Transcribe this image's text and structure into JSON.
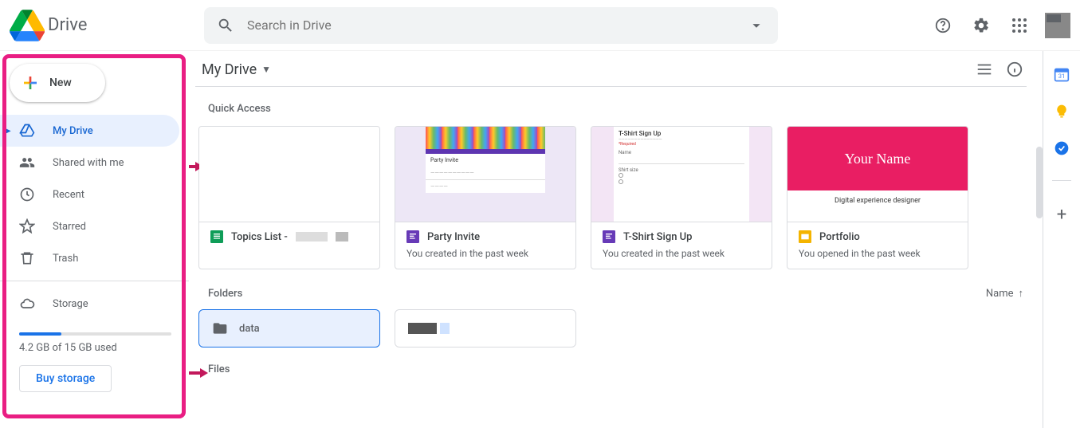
{
  "header": {
    "app_name": "Drive",
    "search_placeholder": "Search in Drive"
  },
  "sidebar": {
    "new_label": "New",
    "items": [
      {
        "label": "My Drive",
        "icon": "drive"
      },
      {
        "label": "Shared with me",
        "icon": "shared"
      },
      {
        "label": "Recent",
        "icon": "recent"
      },
      {
        "label": "Starred",
        "icon": "star"
      },
      {
        "label": "Trash",
        "icon": "trash"
      }
    ],
    "storage_label": "Storage",
    "storage_used_text": "4.2 GB of 15 GB used",
    "storage_percent": 28,
    "buy_label": "Buy storage"
  },
  "main": {
    "breadcrumb": "My Drive",
    "quick_access_label": "Quick Access",
    "folders_label": "Folders",
    "files_label": "Files",
    "sort_label": "Name",
    "quick_access": [
      {
        "title": "Topics List -",
        "subtitle": "",
        "type": "sheets"
      },
      {
        "title": "Party Invite",
        "subtitle": "You created in the past week",
        "type": "forms"
      },
      {
        "title": "T-Shirt Sign Up",
        "subtitle": "You created in the past week",
        "type": "forms"
      },
      {
        "title": "Portfolio",
        "subtitle": "You opened in the past week",
        "type": "slides"
      }
    ],
    "portfolio_thumb": {
      "name": "Your Name",
      "role": "Digital experience designer"
    },
    "party_thumb_title": "Party Invite",
    "tshirt_thumb": {
      "title": "T-Shirt Sign Up",
      "name_label": "Name",
      "size_label": "Shirt size"
    },
    "folders": [
      {
        "name": "data",
        "selected": true
      },
      {
        "name": "",
        "selected": false,
        "redacted": true
      }
    ]
  }
}
